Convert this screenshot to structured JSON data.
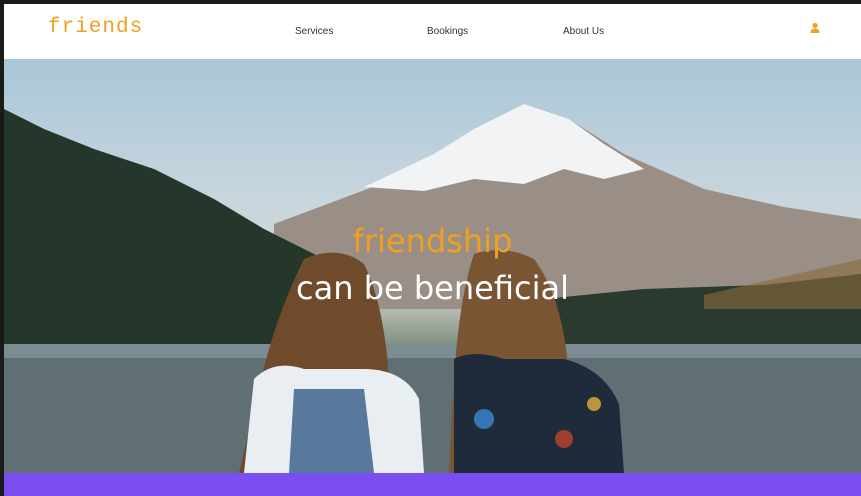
{
  "brand": {
    "logo_text": "friends"
  },
  "nav": {
    "links": [
      {
        "label": "Services"
      },
      {
        "label": "Bookings"
      },
      {
        "label": "About Us"
      }
    ],
    "user_icon": "user-icon"
  },
  "hero": {
    "line1": "friendship",
    "line2": "can be beneficial"
  },
  "colors": {
    "accent": "#f0a020",
    "footer_band": "#7b4ef2"
  }
}
